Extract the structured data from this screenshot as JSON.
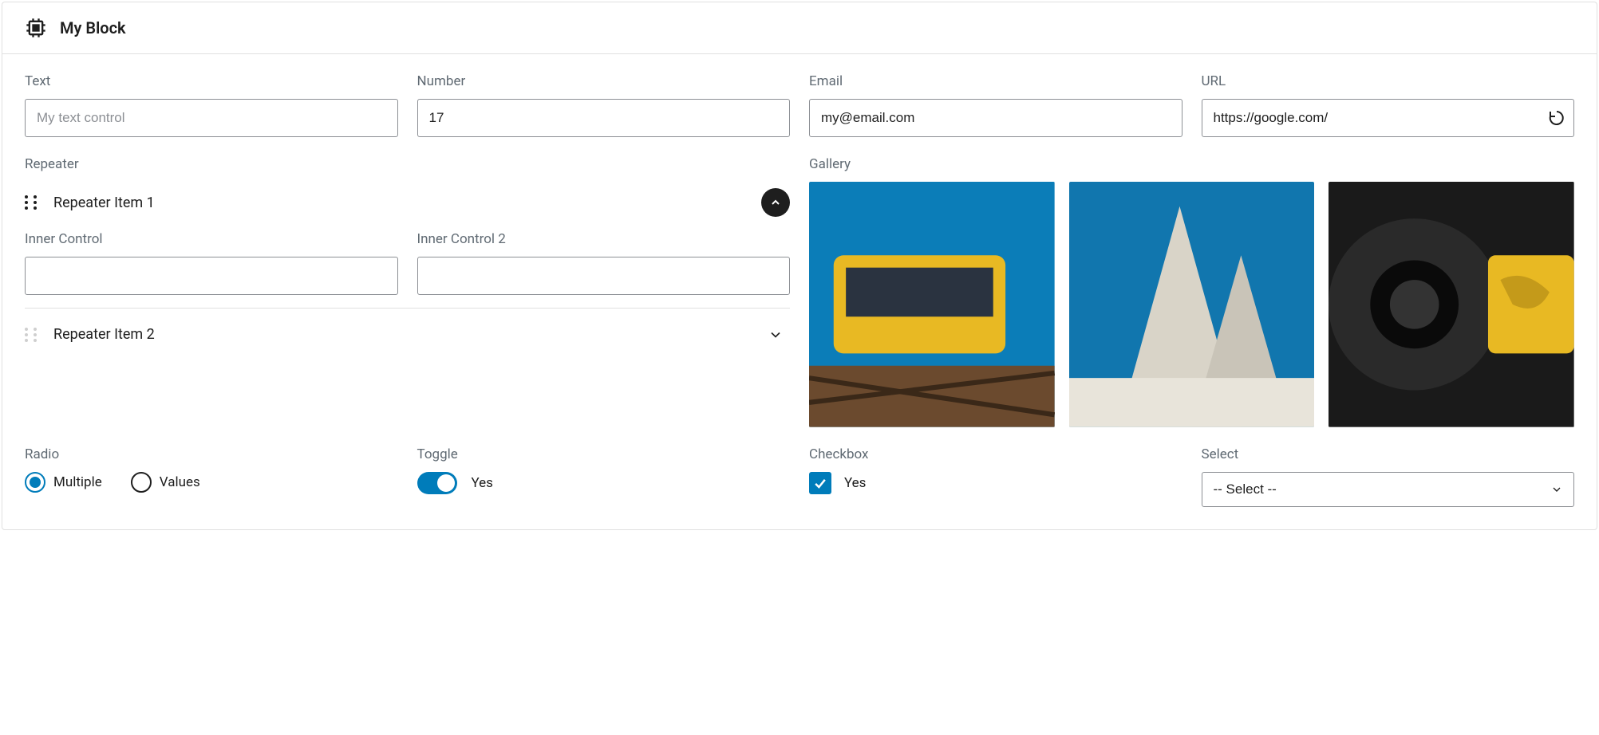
{
  "header": {
    "title": "My Block"
  },
  "fields": {
    "text": {
      "label": "Text",
      "placeholder": "My text control",
      "value": ""
    },
    "number": {
      "label": "Number",
      "value": "17"
    },
    "email": {
      "label": "Email",
      "value": "my@email.com"
    },
    "url": {
      "label": "URL",
      "value": "https://google.com/"
    }
  },
  "repeater": {
    "label": "Repeater",
    "items": [
      {
        "title": "Repeater Item 1",
        "expanded": true,
        "inner1": {
          "label": "Inner Control",
          "value": ""
        },
        "inner2": {
          "label": "Inner Control 2",
          "value": ""
        }
      },
      {
        "title": "Repeater Item 2",
        "expanded": false
      }
    ]
  },
  "gallery": {
    "label": "Gallery"
  },
  "radio": {
    "label": "Radio",
    "options": [
      {
        "label": "Multiple",
        "checked": true
      },
      {
        "label": "Values",
        "checked": false
      }
    ]
  },
  "toggle": {
    "label": "Toggle",
    "value_label": "Yes"
  },
  "checkbox": {
    "label": "Checkbox",
    "value_label": "Yes"
  },
  "select": {
    "label": "Select",
    "placeholder": "-- Select --"
  }
}
